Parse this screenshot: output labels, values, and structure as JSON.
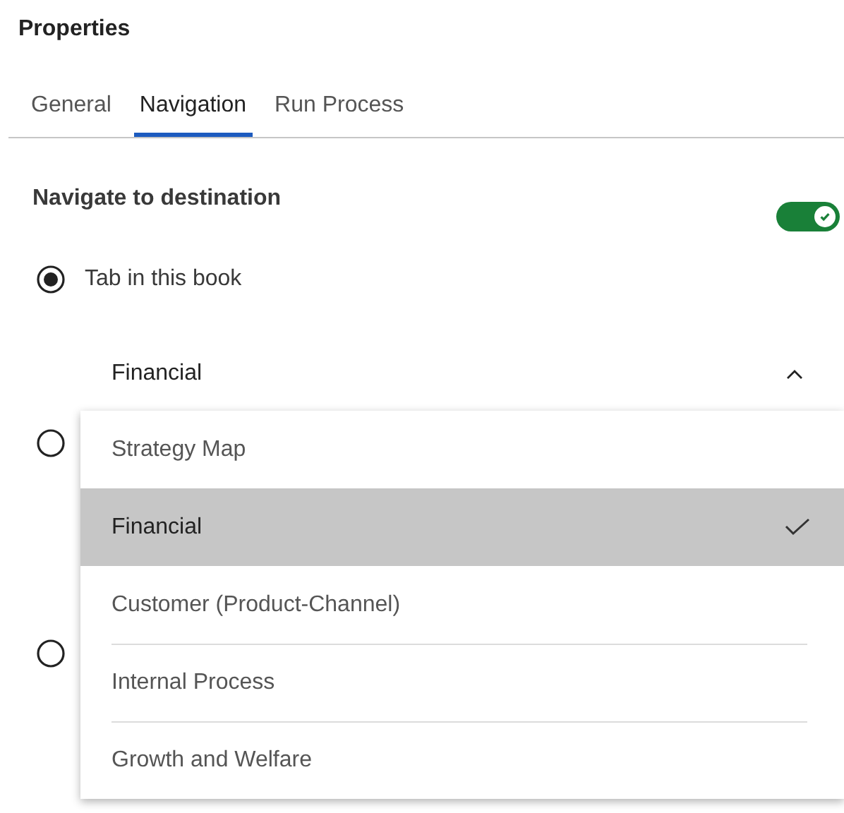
{
  "panel": {
    "title": "Properties"
  },
  "tabs": [
    {
      "label": "General",
      "selected": false
    },
    {
      "label": "Navigation",
      "selected": true
    },
    {
      "label": "Run Process",
      "selected": false
    }
  ],
  "section": {
    "title": "Navigate to destination",
    "toggle_on": true
  },
  "options": [
    {
      "label": "Tab in this book",
      "selected": true
    },
    {
      "selected": false
    },
    {
      "selected": false
    }
  ],
  "dropdown": {
    "value": "Financial",
    "expanded": true,
    "items": [
      {
        "label": "Strategy Map",
        "selected": false
      },
      {
        "label": "Financial",
        "selected": true
      },
      {
        "label": "Customer (Product-Channel)",
        "selected": false
      },
      {
        "label": "Internal Process",
        "selected": false
      },
      {
        "label": "Growth and Welfare",
        "selected": false
      }
    ]
  }
}
